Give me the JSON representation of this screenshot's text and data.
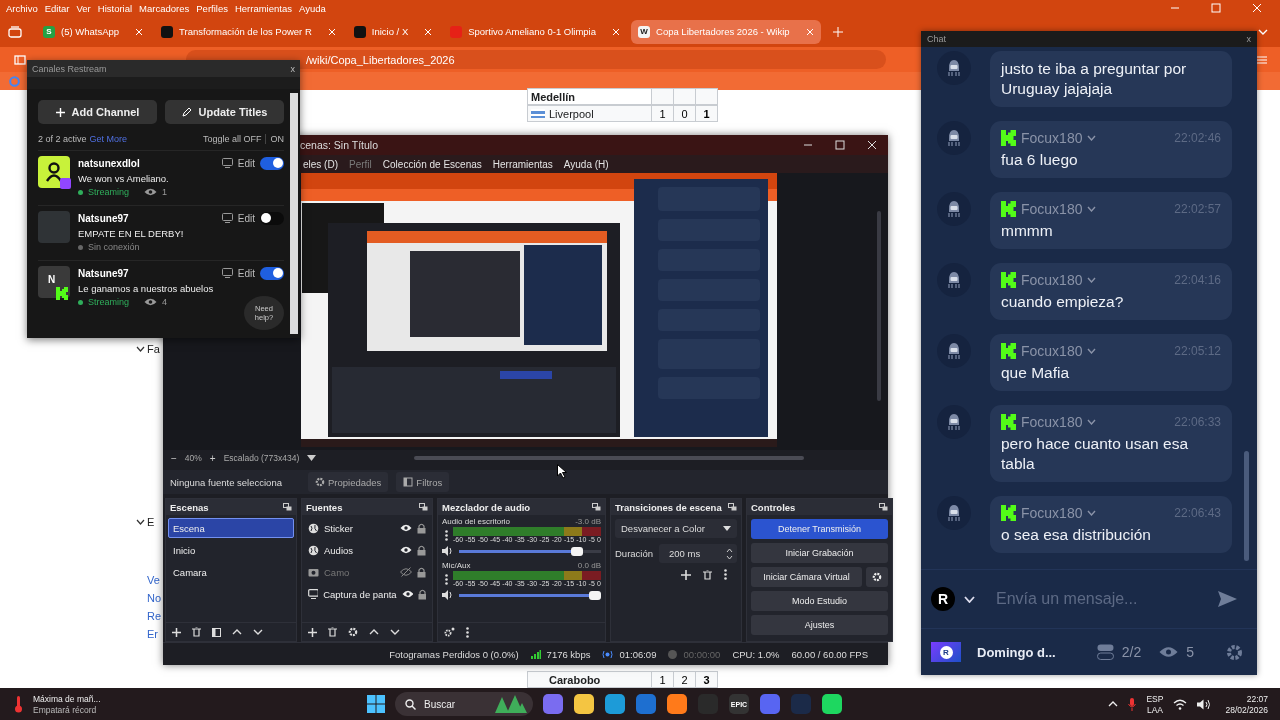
{
  "browser": {
    "menu": [
      "Archivo",
      "Editar",
      "Ver",
      "Historial",
      "Marcadores",
      "Perfiles",
      "Herramientas",
      "Ayuda"
    ],
    "tabs": [
      {
        "title": "(5) WhatsApp",
        "kind": "whatsapp",
        "icon_letter": "S",
        "selected": false
      },
      {
        "title": "Transformación de los Power R",
        "kind": "tiktok",
        "selected": false
      },
      {
        "title": "Inicio / X",
        "kind": "x",
        "selected": false
      },
      {
        "title": "Sportivo Ameliano 0-1 Olimpia",
        "kind": "youtube",
        "selected": false
      },
      {
        "title": "Copa Libertadores 2026 - Wikip",
        "kind": "wiki",
        "icon_letter": "W",
        "selected": true
      }
    ],
    "address": "/wiki/Copa_Libertadores_2026",
    "page": {
      "side_fragments": [
        {
          "text": "Fa",
          "kind": "heading"
        },
        {
          "text": "E",
          "kind": "heading"
        },
        {
          "text": "Ve",
          "kind": "link"
        },
        {
          "text": "No",
          "kind": "link"
        },
        {
          "text": "Re",
          "kind": "link"
        },
        {
          "text": "Er",
          "kind": "link"
        }
      ],
      "table": [
        {
          "team": "Medellín",
          "kind": "group"
        },
        {
          "team": "Liverpool",
          "kind": "team",
          "scores": [
            "1",
            "0",
            "1"
          ]
        }
      ],
      "bottom_row": {
        "team": "Carabobo",
        "scores": [
          "1",
          "2",
          "3"
        ]
      }
    }
  },
  "obs": {
    "title": "cenas: Sin Título",
    "menu": [
      {
        "label": "eles (D)",
        "disabled": false
      },
      {
        "label": "Perfil",
        "disabled": true
      },
      {
        "label": "Colección de Escenas",
        "disabled": false
      },
      {
        "label": "Herramientas",
        "disabled": false
      },
      {
        "label": "Ayuda (H)",
        "disabled": false
      }
    ],
    "zoom": {
      "minus": "−",
      "value": "40%",
      "plus": "+",
      "scale": "Escalado (773x434)"
    },
    "source_label": "Ninguna fuente selecciona",
    "properties": "Propiedades",
    "filters": "Filtros",
    "scenes": {
      "title": "Escenas",
      "items": [
        {
          "label": "Escena",
          "selected": true
        },
        {
          "label": "Inicio",
          "selected": false
        },
        {
          "label": "Camara",
          "selected": false
        }
      ]
    },
    "sources": {
      "title": "Fuentes",
      "items": [
        {
          "label": "Sticker",
          "kind": "browser",
          "visible": true
        },
        {
          "label": "Audios",
          "kind": "browser",
          "visible": true
        },
        {
          "label": "Camo",
          "kind": "camera",
          "visible": false
        },
        {
          "label": "Captura de panta",
          "kind": "display",
          "visible": true
        }
      ]
    },
    "mixer": {
      "title": "Mezclador de audio",
      "channels": [
        {
          "name": "Audio del escritorio",
          "reading": "-3.0 dB",
          "level": 0.86,
          "scale": [
            "-60",
            "-55",
            "-50",
            "-45",
            "-40",
            "-35",
            "-30",
            "-25",
            "-20",
            "-15",
            "-10",
            "-5",
            "0"
          ]
        },
        {
          "name": "Mic/Aux",
          "reading": "0.0 dB",
          "level": 1.0,
          "scale": [
            "-60",
            "-55",
            "-50",
            "-45",
            "-40",
            "-35",
            "-30",
            "-25",
            "-20",
            "-15",
            "-10",
            "-5",
            "0"
          ]
        }
      ]
    },
    "transitions": {
      "title": "Transiciones de escena",
      "selected": "Desvanecer a Color",
      "duration_label": "Duración",
      "duration": "200 ms"
    },
    "controls": {
      "title": "Controles",
      "buttons": [
        {
          "label": "Detener Transmisión",
          "kind": "primary"
        },
        {
          "label": "Iniciar Grabación",
          "kind": "normal"
        },
        {
          "label": "Iniciar Cámara Virtual",
          "kind": "with-settings"
        },
        {
          "label": "Modo Estudio",
          "kind": "normal"
        },
        {
          "label": "Ajustes",
          "kind": "normal"
        }
      ]
    },
    "status": {
      "dropped": "Fotogramas Perdidos 0 (0.0%)",
      "bitrate": "7176 kbps",
      "stream_time": "01:06:09",
      "record_time": "00:00:00",
      "cpu": "CPU: 1.0%",
      "fps": "60.00 / 60.00 FPS"
    }
  },
  "restream": {
    "title": "Canales Restream",
    "close": "x",
    "buttons": [
      "Add Channel",
      "Update Titles"
    ],
    "active_count": "2 of 2 active",
    "get_more": "Get More",
    "toggle_all": "Toggle all OFF",
    "toggle_on": "ON",
    "channels": [
      {
        "name": "natsunexdlol",
        "title": "We won vs Ameliano.",
        "status": "Streaming",
        "streaming": true,
        "viewers": "1",
        "kind": "icon",
        "edit": "Edit",
        "on": true
      },
      {
        "name": "Natsune97",
        "title": "EMPATE EN EL DERBY!",
        "status": "Sin conexión",
        "streaming": false,
        "kind": "photo",
        "edit": "Edit",
        "on": false
      },
      {
        "name": "Natsune97",
        "title": "Le ganamos a nuestros abuelos",
        "status": "Streaming",
        "streaming": true,
        "viewers": "4",
        "kind": "initial",
        "initial": "N",
        "edit": "Edit",
        "on": true
      }
    ],
    "help": "Need help?"
  },
  "chat": {
    "title": "Chat",
    "close": "x",
    "messages": [
      {
        "text": "justo te iba a preguntar por Uruguay jajajaja"
      },
      {
        "user": "Focux180",
        "time": "22:02:46",
        "text": "fua 6 luego"
      },
      {
        "user": "Focux180",
        "time": "22:02:57",
        "text": "mmmm"
      },
      {
        "user": "Focux180",
        "time": "22:04:16",
        "text": "cuando empieza?"
      },
      {
        "user": "Focux180",
        "time": "22:05:12",
        "text": "que Mafia"
      },
      {
        "user": "Focux180",
        "time": "22:06:33",
        "text": "pero hace cuanto usan esa tabla"
      },
      {
        "user": "Focux180",
        "time": "22:06:43",
        "text": "o sea esa distribución"
      }
    ],
    "input_letter": "R",
    "placeholder": "Envía un mensaje...",
    "footer": {
      "logo_letter": "R",
      "name": "Domingo d...",
      "channels": "2/2",
      "viewers": "5"
    }
  },
  "taskbar": {
    "weather": {
      "title": "Máxima de mañ...",
      "subtitle": "Empatará récord"
    },
    "search": "Buscar",
    "apps": [
      {
        "kind": "copilot"
      },
      {
        "kind": "folder"
      },
      {
        "kind": "edge"
      },
      {
        "kind": "mail"
      },
      {
        "kind": "firefox"
      },
      {
        "kind": "obs"
      },
      {
        "kind": "epic",
        "label": "EPIC"
      },
      {
        "kind": "discord"
      },
      {
        "kind": "steam"
      },
      {
        "kind": "spotify"
      }
    ],
    "lang": "ESP",
    "layout": "LAA",
    "time": "22:07",
    "date": "28/02/2026"
  }
}
